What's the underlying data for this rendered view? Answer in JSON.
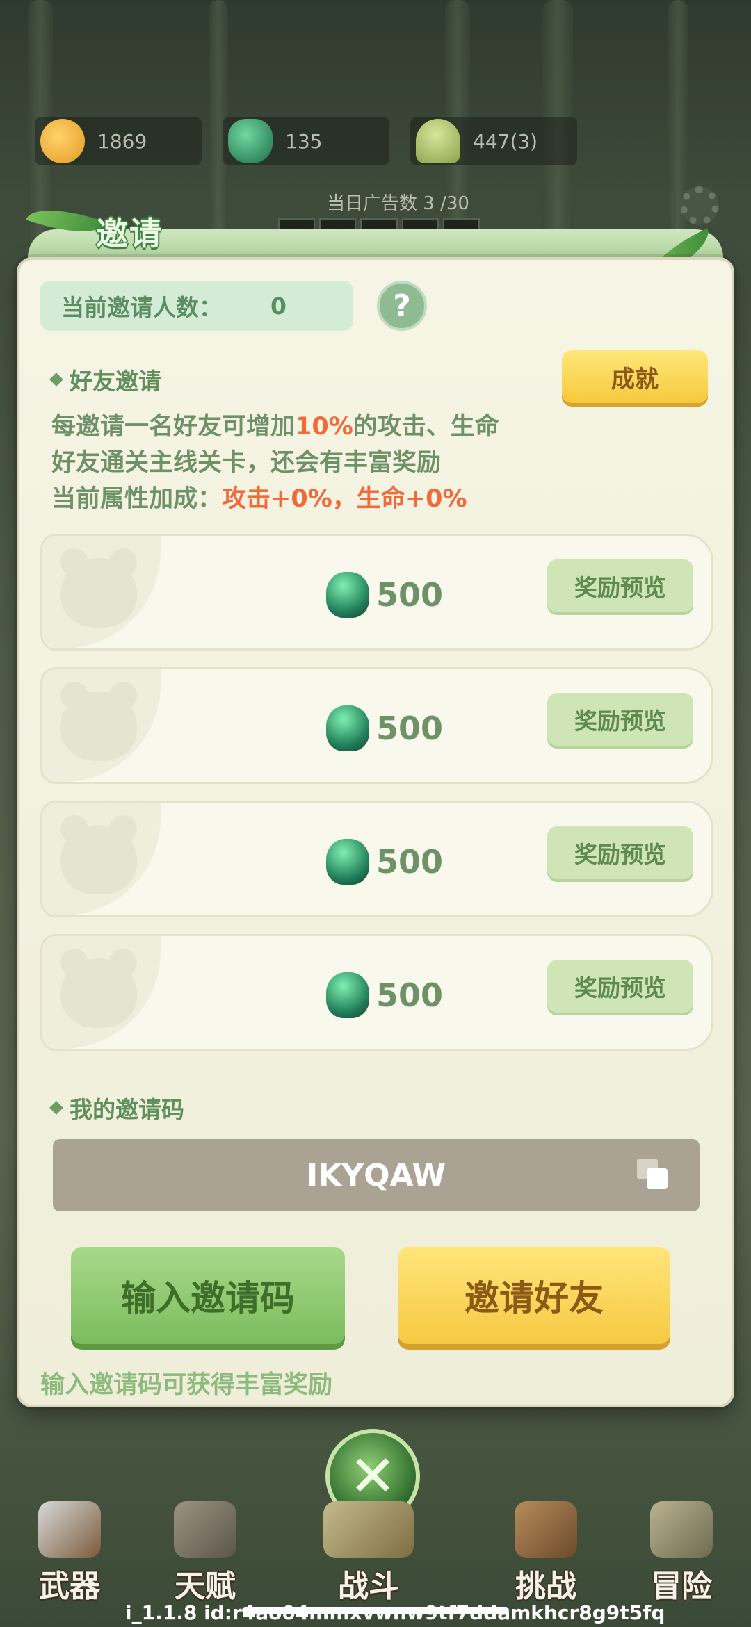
{
  "resources": [
    {
      "icon": "paw-coin-icon",
      "value": "1869"
    },
    {
      "icon": "green-gem-icon",
      "value": "135"
    },
    {
      "icon": "bamboo-shoot-icon",
      "value": "447(3)"
    }
  ],
  "ads": {
    "label": "当日广告数 3 /30"
  },
  "dialog": {
    "title": "邀请",
    "invite_count_label": "当前邀请人数：",
    "invite_count_value": "0",
    "help_symbol": "?",
    "friend_section": "好友邀请",
    "achievement_button": "成就",
    "desc": {
      "line1_pre": "每邀请一名好友可增加",
      "line1_hl": "10%",
      "line1_post": "的攻击、生命",
      "line2": "好友通关主线关卡，还会有丰富奖励",
      "line3_pre": "当前属性加成：",
      "line3_hl": "攻击+0%，生命+0%"
    },
    "reward_cards": [
      {
        "amount": "500",
        "button": "奖励预览"
      },
      {
        "amount": "500",
        "button": "奖励预览"
      },
      {
        "amount": "500",
        "button": "奖励预览"
      },
      {
        "amount": "500",
        "button": "奖励预览"
      }
    ],
    "code_section": "我的邀请码",
    "invite_code": "IKYQAW",
    "enter_code_button": "输入邀请码",
    "invite_friend_button": "邀请好友",
    "hint": "输入邀请码可获得丰富奖励"
  },
  "nav": [
    {
      "label": "武器",
      "icon": "axe-icon"
    },
    {
      "label": "天赋",
      "icon": "talent-book-icon"
    },
    {
      "label": "战斗",
      "icon": "battle-scroll-icon"
    },
    {
      "label": "挑战",
      "icon": "wooden-dummy-icon"
    },
    {
      "label": "冒险",
      "icon": "adventure-scroll-icon"
    }
  ],
  "footer_id": "i_1.1.8 id:r4ao04mmxvwnw9tf7ddamkhcr8g9t5fq"
}
